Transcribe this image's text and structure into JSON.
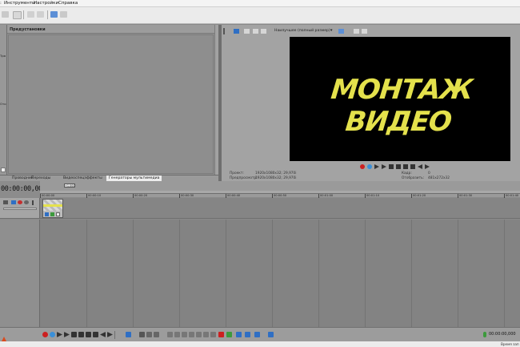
{
  "menu": [
    "Инструменты",
    "Настройки",
    "Справка"
  ],
  "preset_panel": {
    "title": "Предустановки"
  },
  "left_tabs": [
    "Проводник",
    "Переходы",
    "Видеоспецэффекты",
    "Генераторы мультимедиа"
  ],
  "preview": {
    "quality_label": "Наилучшее (полный размер)",
    "video_text": "МОНТАЖ ВИДЕО",
    "info": {
      "project_label": "Проект:",
      "project_value": "1920x1080x32; 29,970i",
      "preview_label": "Предпросмотр:",
      "preview_value": "1920x1080x32; 29,970i",
      "frame_label": "Кадр:",
      "frame_value": "0",
      "display_label": "Отобразить:",
      "display_value": "481x272x32"
    }
  },
  "timeline": {
    "timecode": "00:00:00,000",
    "cursor_label": "+1,000",
    "ruler_labels": [
      "00:00:00",
      "00:00:10",
      "00:00:20",
      "00:00:30",
      "00:00:40",
      "00:00:50",
      "00:01:00",
      "00:01:10",
      "00:01:20",
      "00:01:30",
      "00:01:40"
    ]
  },
  "bottom": {
    "timecode": "00:00:00,000"
  },
  "status": {
    "text": "Время зап"
  },
  "colors": {
    "title_yellow": "#e4e14c",
    "record_red": "#cc2020",
    "ui_blue": "#2f6fc4"
  }
}
